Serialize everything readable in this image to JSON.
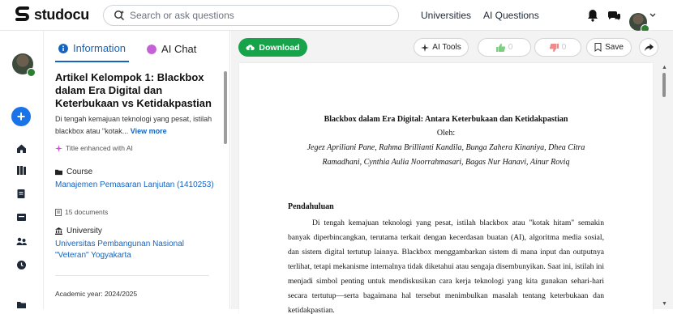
{
  "header": {
    "logo_text": "studocu",
    "search_placeholder": "Search or ask questions",
    "nav": [
      "Universities",
      "AI Questions"
    ]
  },
  "panel": {
    "tabs": [
      {
        "label": "Information",
        "icon": "info-icon"
      },
      {
        "label": "AI Chat",
        "icon": "ai-chat-icon"
      }
    ],
    "title": "Artikel Kelompok 1: Blackbox dalam Era Digital dan Keterbukaan vs Ketidakpastian",
    "description": "Di tengah kemajuan teknologi yang pesat, istilah blackbox atau \"kotak...",
    "view_more": "View more",
    "enhanced": "Title enhanced with AI",
    "course": {
      "heading": "Course",
      "name": "Manajemen Pemasaran Lanjutan (1410253)",
      "docs": "15 documents"
    },
    "university": {
      "heading": "University",
      "name": "Universitas Pembangunan Nasional \"Veteran\" Yogyakarta"
    },
    "academic_year": "Academic year: 2024/2025"
  },
  "toolbar": {
    "download": "Download",
    "ai_tools": "AI Tools",
    "likes": "0",
    "dislikes": "0",
    "save": "Save"
  },
  "document": {
    "title": "Blackbox dalam Era Digital: Antara Keterbukaan dan Ketidakpastian",
    "oleh": "Oleh:",
    "authors": "Jegez Apriliani Pane, Rahma Brillianti Kandila, Bunga Zahera Kinaniya, Dhea Citra Ramadhani, Cynthia Aulia Noorrahmasari, Bagas Nur Hanavi, Ainur Roviq",
    "section_heading": "Pendahuluan",
    "body": "Di tengah kemajuan teknologi yang pesat, istilah blackbox atau \"kotak hitam\" semakin banyak diperbincangkan, terutama terkait dengan kecerdasan buatan (AI), algoritma media sosial, dan sistem digital tertutup lainnya. Blackbox menggambarkan sistem di mana input dan outputnya terlihat, tetapi mekanisme internalnya tidak diketahui atau sengaja disembunyikan. Saat ini, istilah ini menjadi simbol penting untuk mendiskusikan cara kerja teknologi yang kita gunakan sehari-hari secara tertutup—serta bagaimana hal tersebut menimbulkan masalah tentang keterbukaan dan ketidakpastian."
  },
  "colors": {
    "brand_blue": "#1565c0",
    "download_green": "#16a34a",
    "add_button": "#1a73e8"
  }
}
